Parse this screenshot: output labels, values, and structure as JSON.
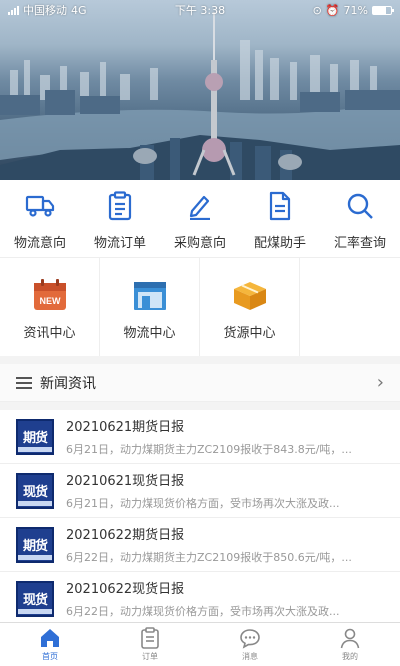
{
  "status_bar": {
    "carrier": "中国移动",
    "network": "4G",
    "time": "下午 3:38",
    "battery_text": "71%",
    "battery_level": 0.71
  },
  "quick_nav": [
    {
      "label": "物流意向",
      "icon": "truck-icon"
    },
    {
      "label": "物流订单",
      "icon": "clipboard-icon"
    },
    {
      "label": "采购意向",
      "icon": "pencil-icon"
    },
    {
      "label": "配煤助手",
      "icon": "document-icon"
    },
    {
      "label": "汇率查询",
      "icon": "search-icon"
    }
  ],
  "modules": [
    {
      "label": "资讯中心",
      "icon": "calendar-new-icon",
      "badge": "NEW"
    },
    {
      "label": "物流中心",
      "icon": "warehouse-icon"
    },
    {
      "label": "货源中心",
      "icon": "box-icon"
    }
  ],
  "news": {
    "title": "新闻资讯",
    "items": [
      {
        "title": "20210621期货日报",
        "snippet": "6月21日，动力煤期货主力ZC2109报收于843.8元/吨，...",
        "thumb": "期货"
      },
      {
        "title": "20210621现货日报",
        "snippet": "6月21日，动力煤现货价格方面，受市场再次大涨及政...",
        "thumb": "现货"
      },
      {
        "title": "20210622期货日报",
        "snippet": "6月22日，动力煤期货主力ZC2109报收于850.6元/吨，...",
        "thumb": "期货"
      },
      {
        "title": "20210622现货日报",
        "snippet": "6月22日，动力煤现货价格方面，受市场再次大涨及政...",
        "thumb": "现货"
      }
    ]
  },
  "tabbar": [
    {
      "label": "首页",
      "icon": "home-icon",
      "active": true
    },
    {
      "label": "订单",
      "icon": "order-icon",
      "active": false
    },
    {
      "label": "消息",
      "icon": "chat-icon",
      "active": false
    },
    {
      "label": "我的",
      "icon": "user-icon",
      "active": false
    }
  ],
  "colors": {
    "accent": "#2f6fd6",
    "icon_blue": "#2b6bd0",
    "thumb_blue": "#1f3f8f"
  }
}
